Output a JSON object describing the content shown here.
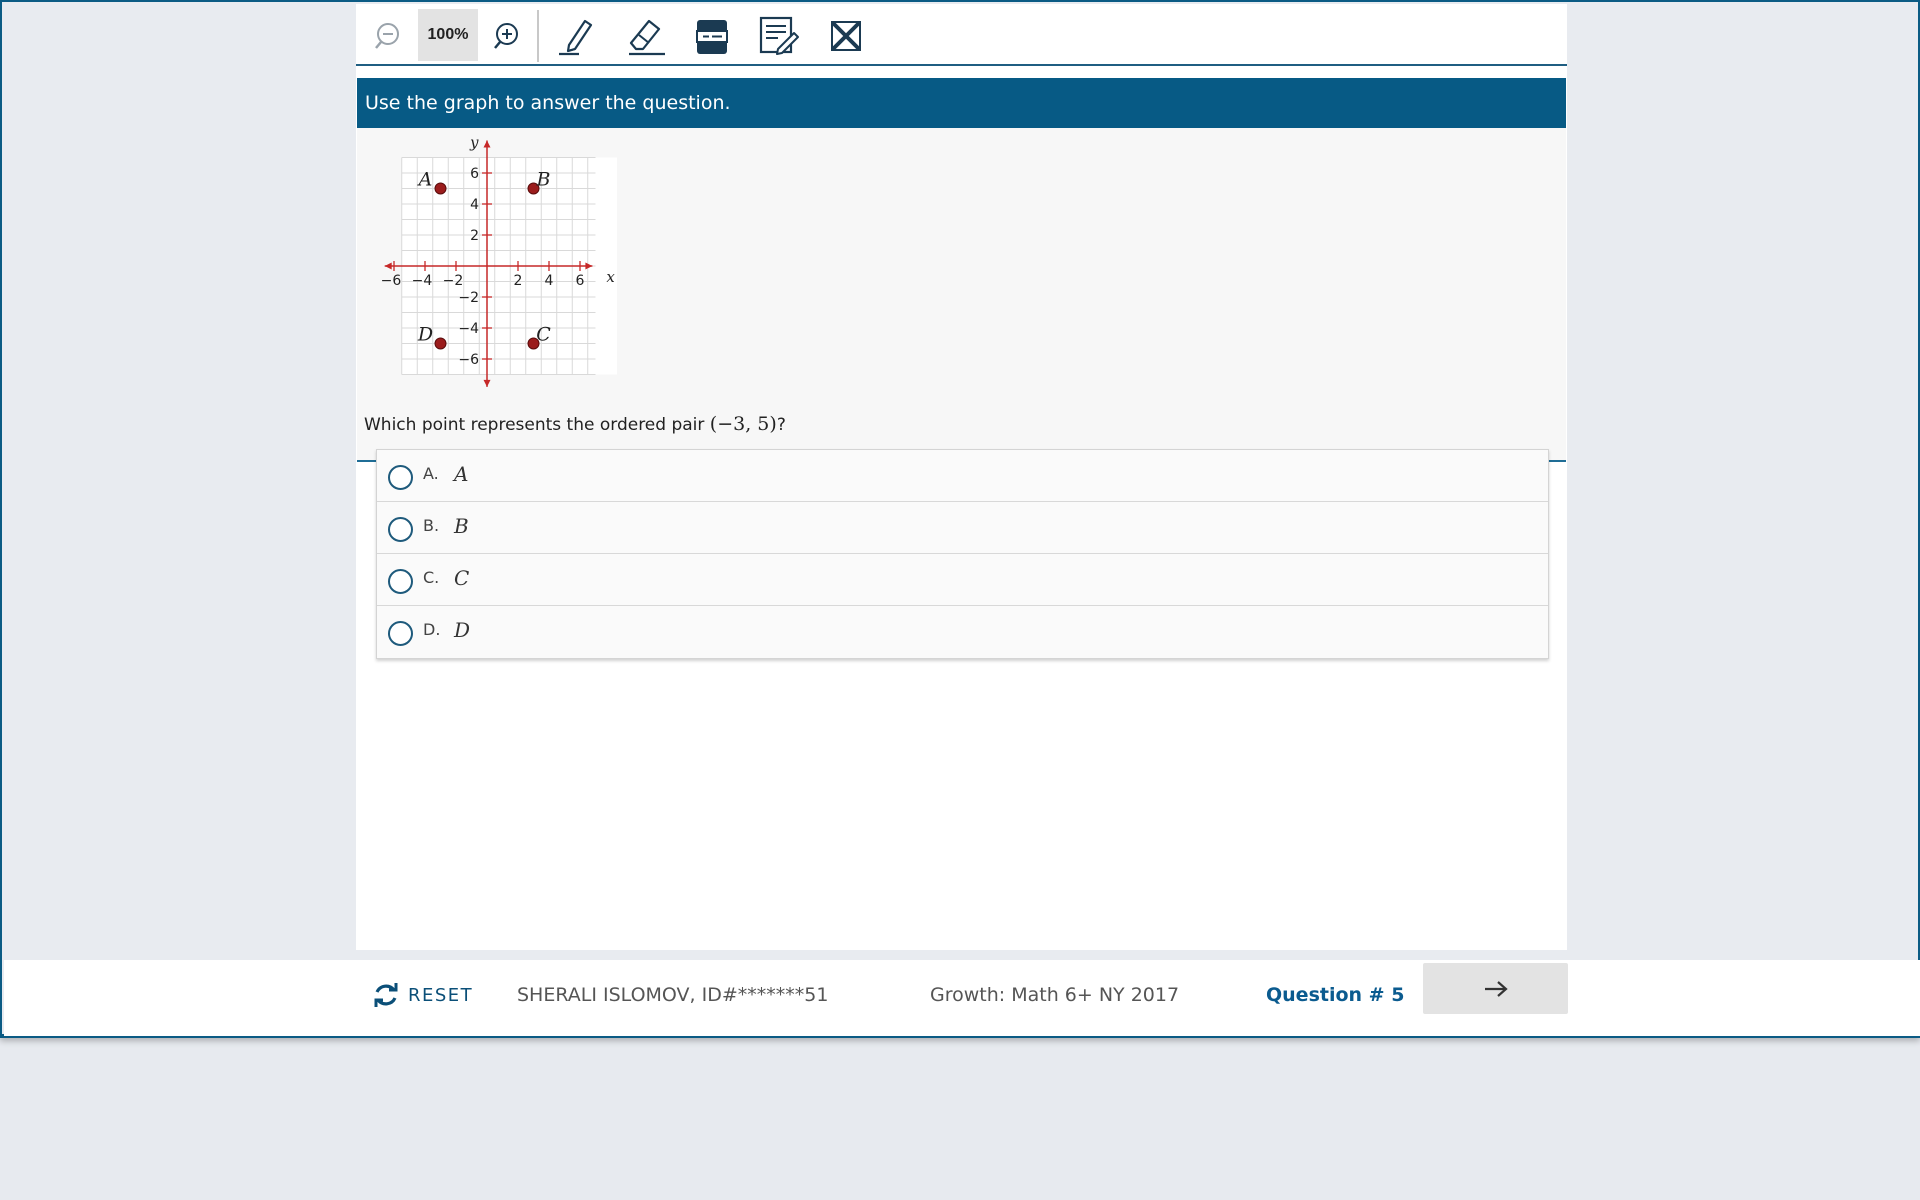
{
  "toolbar": {
    "zoom_level": "100%",
    "tools": [
      {
        "icon": "zoom-out-icon"
      },
      {
        "icon": "zoom-in-icon"
      },
      {
        "icon": "highlighter-icon"
      },
      {
        "icon": "eraser-icon"
      },
      {
        "icon": "line-reader-icon"
      },
      {
        "icon": "notepad-icon"
      },
      {
        "icon": "answer-eliminator-icon"
      }
    ]
  },
  "instruction": "Use the graph to answer the question.",
  "graph": {
    "x_label": "x",
    "y_label": "y",
    "x_ticks": [
      "−6",
      "−4",
      "−2",
      "2",
      "4",
      "6"
    ],
    "y_ticks": [
      "6",
      "4",
      "2",
      "−2",
      "−4",
      "−6"
    ],
    "points": [
      {
        "label": "A",
        "x": -3,
        "y": 5
      },
      {
        "label": "B",
        "x": 3,
        "y": 5
      },
      {
        "label": "C",
        "x": 3,
        "y": -5
      },
      {
        "label": "D",
        "x": -3,
        "y": -5
      }
    ],
    "axis_color": "#c62828",
    "point_color": "#9b1c1c"
  },
  "question": {
    "text": "Which point represents the ordered pair ",
    "math": "(−3, 5)",
    "suffix": "?"
  },
  "choices": [
    {
      "letter": "A.",
      "value": "A"
    },
    {
      "letter": "B.",
      "value": "B"
    },
    {
      "letter": "C.",
      "value": "C"
    },
    {
      "letter": "D.",
      "value": "D"
    }
  ],
  "footer": {
    "reset_label": "RESET",
    "student": "SHERALI ISLOMOV, ID#*******51",
    "test_name": "Growth: Math 6+ NY 2017",
    "question_number": "Question # 5"
  },
  "colors": {
    "brand": "#075a85",
    "link": "#0b5b8f"
  }
}
